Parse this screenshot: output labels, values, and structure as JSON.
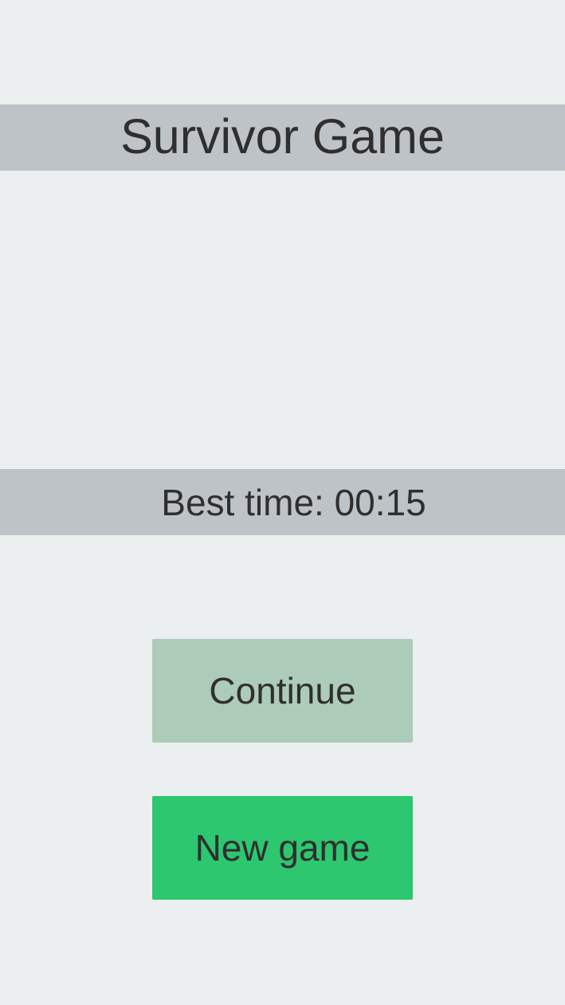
{
  "title": "Survivor Game",
  "best_time": {
    "text": "Best time: 00:15"
  },
  "buttons": {
    "continue_label": "Continue",
    "new_game_label": "New game"
  },
  "colors": {
    "background": "#ebeff0",
    "band": "#bec3c7",
    "continue_button": "#adcbb9",
    "new_game_button": "#2dc76f",
    "text": "#2f2f2f"
  }
}
